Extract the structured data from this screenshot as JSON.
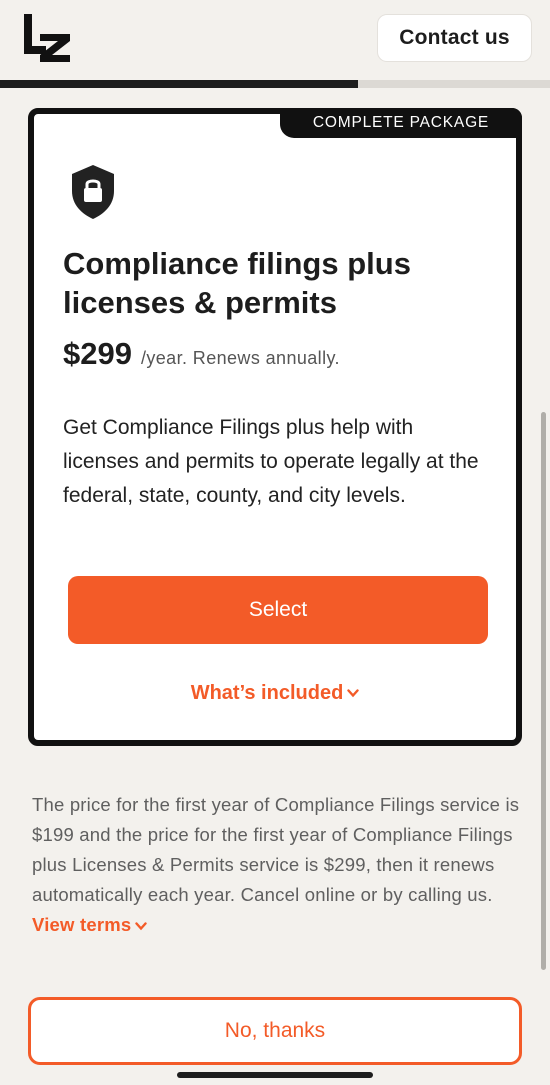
{
  "header": {
    "logo_icon": "lz-logo",
    "contact_label": "Contact us"
  },
  "progress": {
    "fraction": 0.65
  },
  "card": {
    "badge": "COMPLETE PACKAGE",
    "icon": "shield-lock-icon",
    "title": "Compliance filings plus licenses & permits",
    "price": "$299",
    "price_note": "/year. Renews annually.",
    "description": "Get Compliance Filings plus help with licenses and permits to operate legally at the federal, state, county, and city levels.",
    "select_label": "Select",
    "whats_included_label": "What’s included"
  },
  "disclaimer": {
    "text": "The price for the first year of Compliance Filings service is $199 and the price for the first year of Compliance Filings plus Licenses & Permits service is $299, then it renews automatically each year. Cancel online or by calling us.",
    "link_label": "View terms"
  },
  "footer": {
    "no_thanks_label": "No, thanks"
  },
  "colors": {
    "accent": "#f35b28",
    "dark": "#111111",
    "background": "#f3f1ed"
  }
}
